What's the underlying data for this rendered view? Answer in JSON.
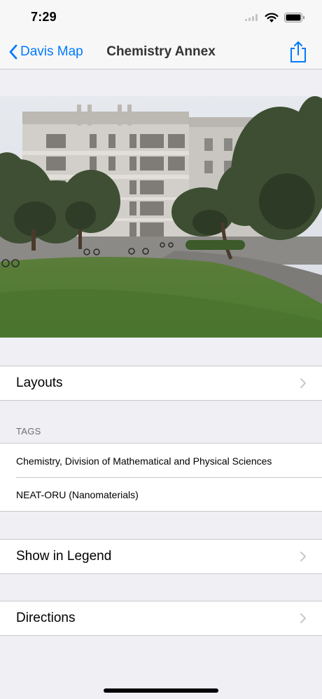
{
  "status_bar": {
    "time": "7:29"
  },
  "nav": {
    "back_label": "Davis Map",
    "title": "Chemistry Annex"
  },
  "photo": {
    "subject": "building-photo"
  },
  "rows": {
    "layouts": "Layouts",
    "show_in_legend": "Show in Legend",
    "directions": "Directions"
  },
  "tags": {
    "header": "TAGS",
    "items": [
      "Chemistry, Division of Mathematical and Physical Sciences",
      "NEAT-ORU (Nanomaterials)"
    ]
  },
  "colors": {
    "accent": "#007aff",
    "background": "#efeff4",
    "separator": "#c8c8cc",
    "chevron": "#c7c7cc"
  }
}
